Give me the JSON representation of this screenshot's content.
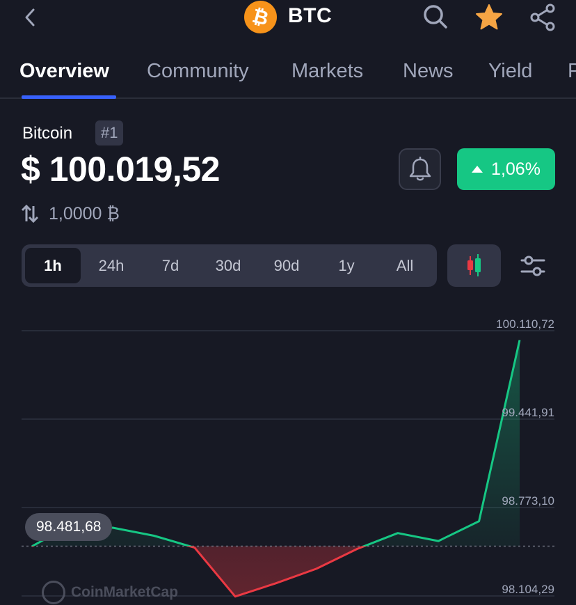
{
  "header": {
    "title": "BTC",
    "coin_logo_glyph": "₿",
    "back_icon": "chevron-left-icon",
    "search_icon": "search-icon",
    "favorite_icon": "star-icon",
    "share_icon": "share-icon",
    "favorite_color": "#f6a544"
  },
  "tabs": [
    {
      "label": "Overview",
      "active": true
    },
    {
      "label": "Community",
      "active": false
    },
    {
      "label": "Markets",
      "active": false
    },
    {
      "label": "News",
      "active": false
    },
    {
      "label": "Yield",
      "active": false
    },
    {
      "label": "P",
      "active": false
    }
  ],
  "coin": {
    "name": "Bitcoin",
    "rank": "#1",
    "price": "$ 100.019,52",
    "change": "1,06%",
    "change_direction": "up",
    "convert_amount": "1,0000 ₿",
    "alert_icon": "bell-icon",
    "convert_icon": "swap-vertical-icon"
  },
  "time_ranges": [
    {
      "label": "1h",
      "active": true
    },
    {
      "label": "24h",
      "active": false
    },
    {
      "label": "7d",
      "active": false
    },
    {
      "label": "30d",
      "active": false
    },
    {
      "label": "90d",
      "active": false
    },
    {
      "label": "1y",
      "active": false
    },
    {
      "label": "All",
      "active": false
    }
  ],
  "chart_toggle_icon": "candlestick-icon",
  "chart_settings_icon": "sliders-icon",
  "colors": {
    "up": "#16c784",
    "down": "#ea3943",
    "accent": "#3861fb",
    "background": "#171924"
  },
  "chart_data": {
    "type": "line",
    "y_tick_labels": [
      "100.110,72",
      "99.441,91",
      "98.773,10",
      "98.104,29"
    ],
    "ylim": [
      97.9,
      100.25
    ],
    "reference_value": 98.481,
    "reference_label": "98.481,68",
    "x": [
      0,
      1,
      2,
      3,
      4,
      5,
      6,
      7,
      8,
      9,
      10,
      11,
      12
    ],
    "values": [
      98.48,
      98.65,
      98.62,
      98.56,
      98.47,
      98.1,
      98.2,
      98.31,
      98.46,
      98.58,
      98.52,
      98.67,
      100.04
    ],
    "watermark": "CoinMarketCap",
    "grid": true
  }
}
